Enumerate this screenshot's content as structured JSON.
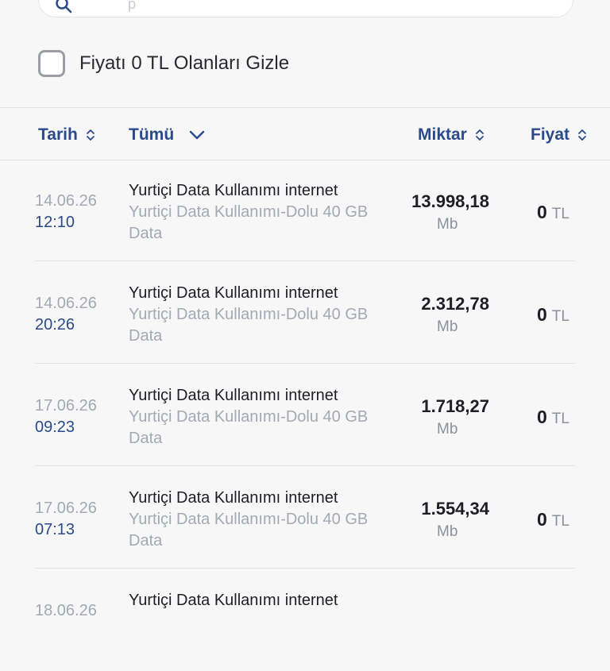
{
  "search": {
    "placeholder": "p"
  },
  "filter": {
    "label": "Fiyatı 0 TL Olanları Gizle",
    "checked": false
  },
  "header": {
    "date": "Tarih",
    "type": "Tümü",
    "amount": "Miktar",
    "price": "Fiyat"
  },
  "rows": [
    {
      "date": "14.06.26",
      "time": "12:10",
      "title": "Yurtiçi Data Kullanımı internet",
      "sub": "Yurtiçi Data Kullanımı-Dolu 40 GB Data",
      "amount": "13.998,18",
      "unit": "Mb",
      "price": "0",
      "currency": "TL"
    },
    {
      "date": "14.06.26",
      "time": "20:26",
      "title": "Yurtiçi Data Kullanımı internet",
      "sub": "Yurtiçi Data Kullanımı-Dolu 40 GB Data",
      "amount": "2.312,78",
      "unit": "Mb",
      "price": "0",
      "currency": "TL"
    },
    {
      "date": "17.06.26",
      "time": "09:23",
      "title": "Yurtiçi Data Kullanımı internet",
      "sub": "Yurtiçi Data Kullanımı-Dolu 40 GB Data",
      "amount": "1.718,27",
      "unit": "Mb",
      "price": "0",
      "currency": "TL"
    },
    {
      "date": "17.06.26",
      "time": "07:13",
      "title": "Yurtiçi Data Kullanımı internet",
      "sub": "Yurtiçi Data Kullanımı-Dolu 40 GB Data",
      "amount": "1.554,34",
      "unit": "Mb",
      "price": "0",
      "currency": "TL"
    },
    {
      "date": "18.06.26",
      "time": "",
      "title": "Yurtiçi Data Kullanımı internet",
      "sub": "",
      "amount": "",
      "unit": "",
      "price": "",
      "currency": ""
    }
  ],
  "colors": {
    "accent": "#2b4a8b",
    "muted": "#a3a8b3",
    "text": "#1e1f24"
  }
}
